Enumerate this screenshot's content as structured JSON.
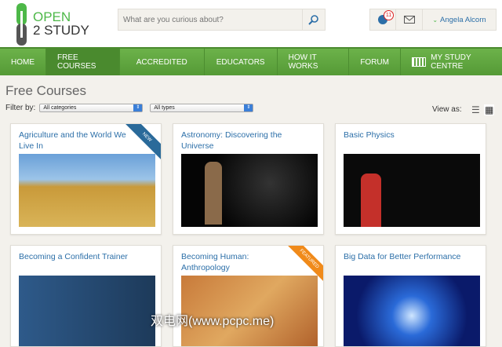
{
  "header": {
    "logo_line1": "OPEN",
    "logo_line2": "2 STUDY",
    "search_placeholder": "What are you curious about?",
    "notification_count": "11",
    "user_name": "Angela Alcorn"
  },
  "nav": [
    "HOME",
    "FREE COURSES",
    "ACCREDITED",
    "EDUCATORS",
    "HOW IT WORKS",
    "FORUM",
    "MY STUDY CENTRE"
  ],
  "page_title": "Free Courses",
  "filter": {
    "label": "Filter by:",
    "category": "All categories",
    "type": "All types",
    "view_as": "View as:"
  },
  "courses": [
    {
      "title": "Agriculture and the World We Live In",
      "ribbon": "NEW"
    },
    {
      "title": "Astronomy: Discovering the Universe"
    },
    {
      "title": "Basic Physics"
    },
    {
      "title": "Becoming a Confident Trainer"
    },
    {
      "title": "Becoming Human: Anthropology",
      "ribbon": "FEATURED"
    },
    {
      "title": "Big Data for Better Performance"
    }
  ],
  "watermark": "双电网(www.pcpc.me)"
}
